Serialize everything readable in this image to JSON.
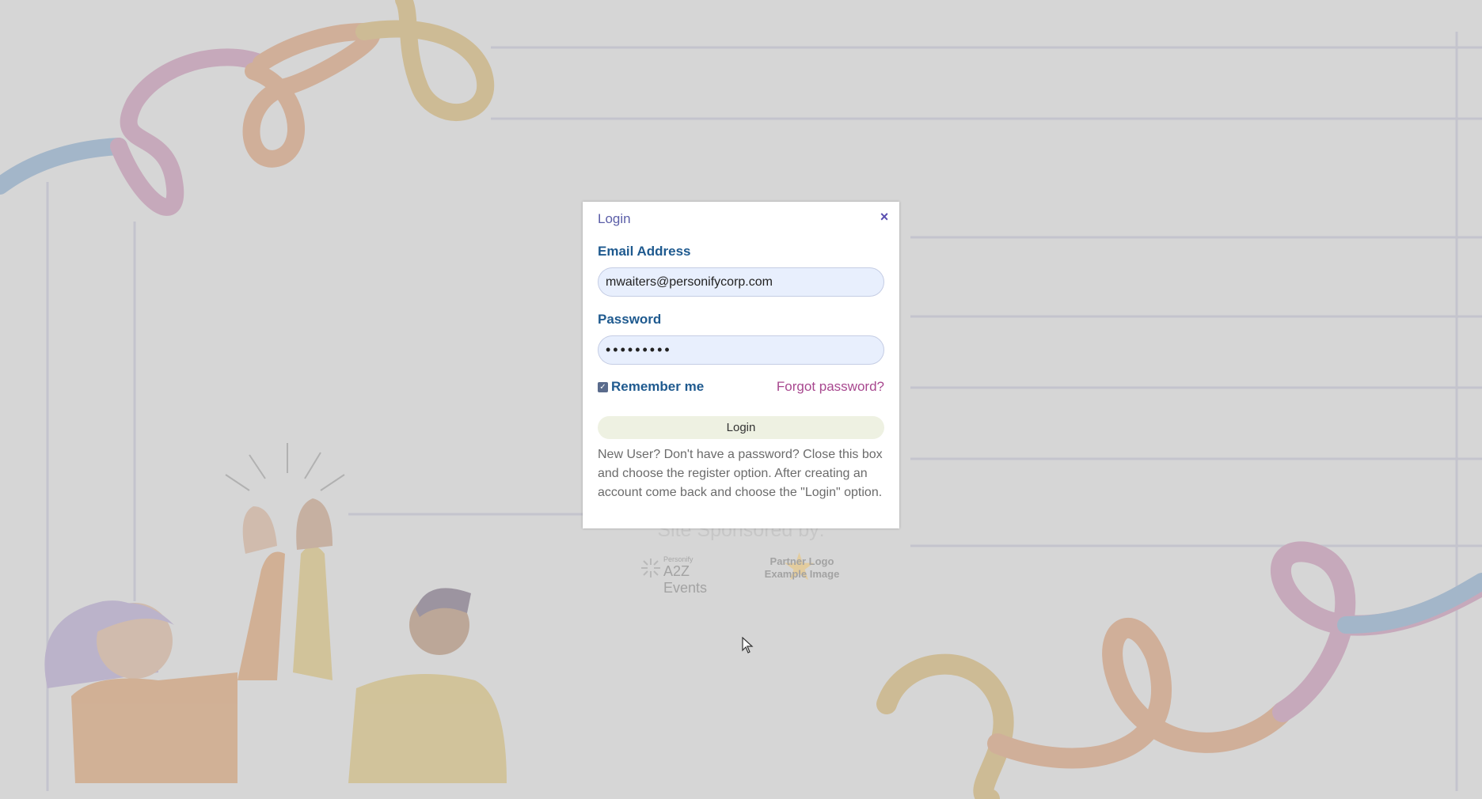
{
  "modal": {
    "title": "Login",
    "close_glyph": "×",
    "email_label": "Email Address",
    "email_value": "mwaiters@personifycorp.com",
    "password_label": "Password",
    "password_masked": "•••••••••",
    "remember_label": "Remember me",
    "remember_checked": true,
    "forgot_label": "Forgot password?",
    "login_button": "Login",
    "info_text": "New User? Don't have a password? Close this box and choose the register option. After creating an account come back and choose the \"Login\" option."
  },
  "sponsors": {
    "title": "Site Sponsored by:",
    "logo1_small": "Personify",
    "logo1_name": "A2Z Events",
    "logo2_line1": "Partner Logo",
    "logo2_line2": "Example Image"
  },
  "colors": {
    "label_blue": "#1f5a8f",
    "forgot_pink": "#a8488f",
    "title_purple": "#5b5ea8",
    "input_bg": "#e8effd"
  },
  "icons": [
    "close-icon",
    "checkbox-checked-icon",
    "mouse-cursor-icon",
    "star-icon"
  ]
}
